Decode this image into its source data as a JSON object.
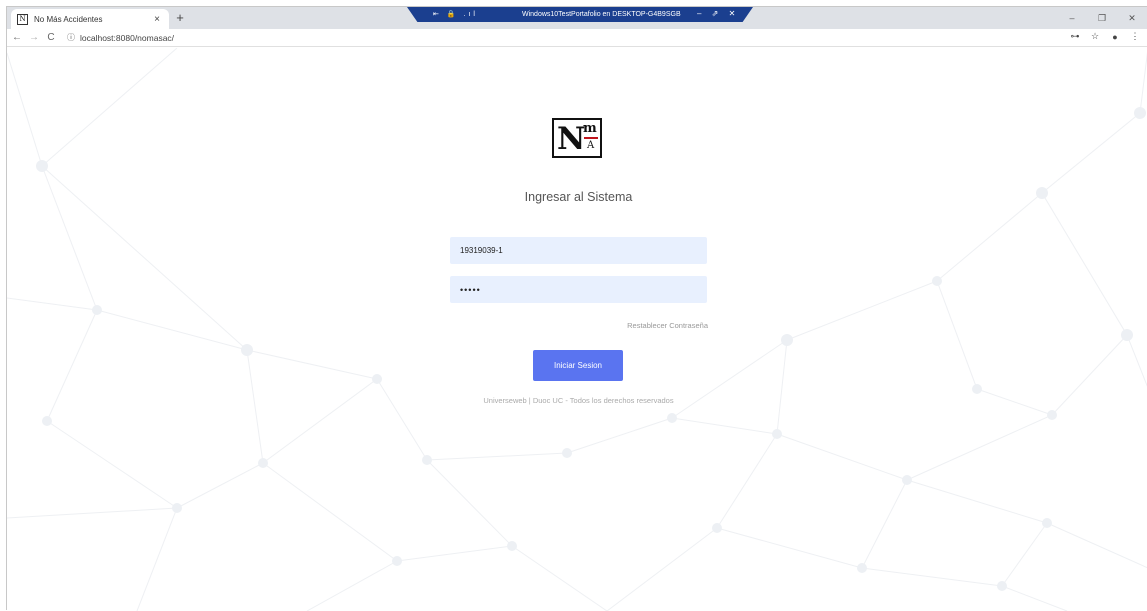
{
  "browser": {
    "tab_title": "No Más Accidentes",
    "tab_close": "×",
    "new_tab": "+",
    "url": "localhost:8080/nomasac/",
    "remote_bar_title": "Windows10TestPortafolio en DESKTOP-G4B9SGB",
    "remote_bar_left": "⇤ 🔒 .ıl",
    "remote_bar_right": "– ⇗ ✕",
    "window_controls": [
      "–",
      "❐",
      "✕"
    ]
  },
  "icons": {
    "back": "←",
    "forward": "→",
    "reload": "C",
    "info": "ⓘ",
    "key": "⊶",
    "star": "☆",
    "account": "●",
    "menu": "⋮"
  },
  "logo": {
    "main": "N",
    "top": "m",
    "bottom": "A",
    "accent_color": "#c0141c"
  },
  "login": {
    "heading": "Ingresar al Sistema",
    "username_value": "19319039-1",
    "password_value": "•••••",
    "reset_link": "Restablecer Contraseña",
    "submit_label": "Iniciar Sesion",
    "footer": "Universeweb | Duoc UC - Todos los derechos reservados"
  },
  "colors": {
    "button": "#5a74f0",
    "input_bg": "#e8f0fe",
    "remote_bar": "#1b3f8f"
  }
}
